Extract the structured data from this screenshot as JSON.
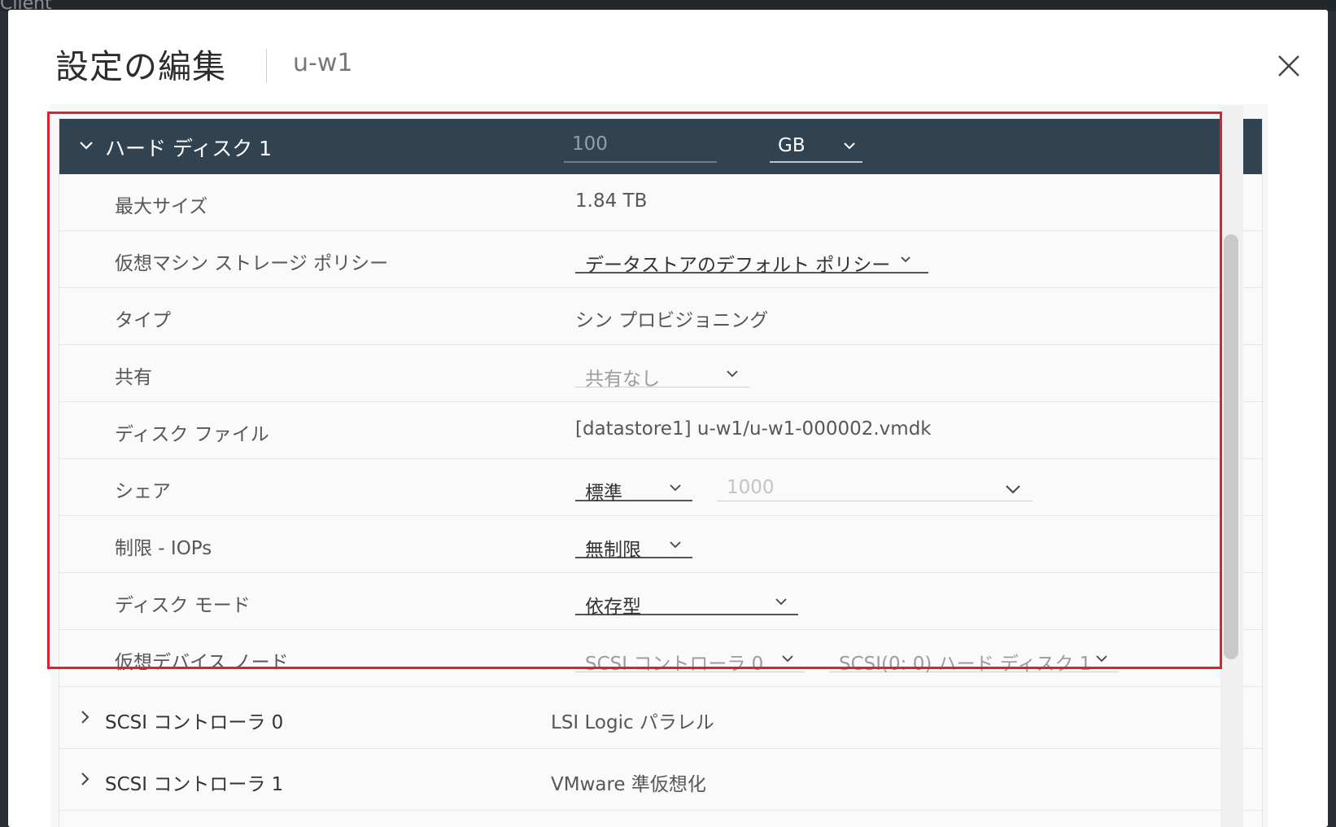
{
  "background": {
    "app_text": "Client"
  },
  "dialog": {
    "title": "設定の編集",
    "subtitle": "u-w1",
    "close_icon": "close-icon"
  },
  "hard_disk": {
    "label": "ハード ディスク 1",
    "size_value": "100",
    "size_unit": "GB",
    "rows": {
      "max_size": {
        "label": "最大サイズ",
        "value": "1.84 TB"
      },
      "storage_policy": {
        "label": "仮想マシン ストレージ ポリシー",
        "value": "データストアのデフォルト ポリシー"
      },
      "type": {
        "label": "タイプ",
        "value": "シン プロビジョニング"
      },
      "sharing": {
        "label": "共有",
        "value": "共有なし"
      },
      "disk_file": {
        "label": "ディスク ファイル",
        "value": "[datastore1] u-w1/u-w1-000002.vmdk"
      },
      "shares": {
        "label": "シェア",
        "value": "標準",
        "amount": "1000"
      },
      "limit_iops": {
        "label": "制限 - IOPs",
        "value": "無制限"
      },
      "disk_mode": {
        "label": "ディスク モード",
        "value": "依存型"
      },
      "device_node": {
        "label": "仮想デバイス ノード",
        "controller": "SCSI コントローラ 0",
        "node": "SCSI(0: 0) ハード ディスク 1"
      }
    }
  },
  "collapsed": [
    {
      "label": "SCSI コントローラ 0",
      "value": "LSI Logic パラレル"
    },
    {
      "label": "SCSI コントローラ 1",
      "value": "VMware 準仮想化"
    }
  ],
  "colors": {
    "header_bg": "#314351",
    "highlight": "#e31e2d"
  }
}
